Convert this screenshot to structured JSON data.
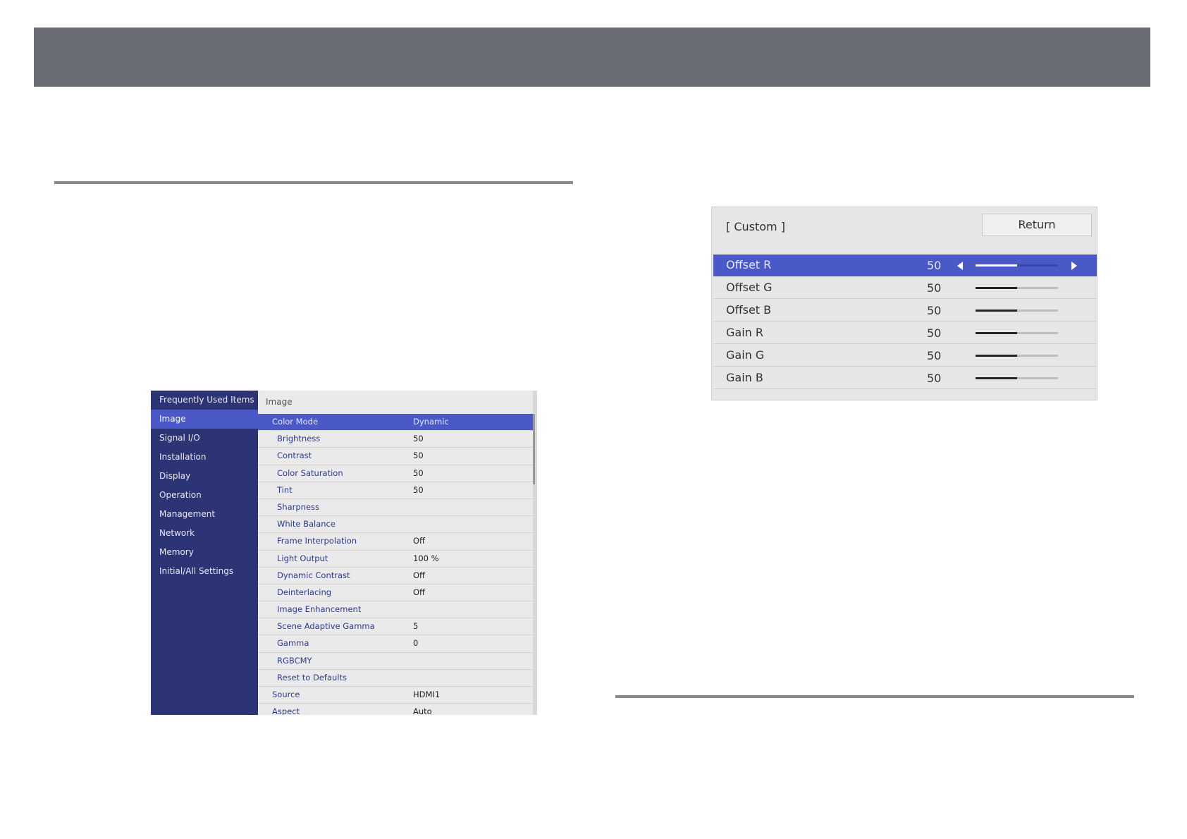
{
  "menu": {
    "sidebar": [
      {
        "label": "Frequently Used Items",
        "active": false
      },
      {
        "label": "Image",
        "active": true
      },
      {
        "label": "Signal I/O",
        "active": false
      },
      {
        "label": "Installation",
        "active": false
      },
      {
        "label": "Display",
        "active": false
      },
      {
        "label": "Operation",
        "active": false
      },
      {
        "label": "Management",
        "active": false
      },
      {
        "label": "Network",
        "active": false
      },
      {
        "label": "Memory",
        "active": false
      },
      {
        "label": "Initial/All Settings",
        "active": false
      }
    ],
    "main_title": "Image",
    "rows": [
      {
        "label": "Color Mode",
        "value": "Dynamic"
      },
      {
        "label": "Brightness",
        "value": "50"
      },
      {
        "label": "Contrast",
        "value": "50"
      },
      {
        "label": "Color Saturation",
        "value": "50"
      },
      {
        "label": "Tint",
        "value": "50"
      },
      {
        "label": "Sharpness",
        "value": ""
      },
      {
        "label": "White Balance",
        "value": ""
      },
      {
        "label": "Frame Interpolation",
        "value": "Off"
      },
      {
        "label": "Light Output",
        "value": "100 %"
      },
      {
        "label": "Dynamic Contrast",
        "value": "Off"
      },
      {
        "label": "Deinterlacing",
        "value": "Off"
      },
      {
        "label": "Image Enhancement",
        "value": ""
      },
      {
        "label": "Scene Adaptive Gamma",
        "value": "5"
      },
      {
        "label": "Gamma",
        "value": "0"
      },
      {
        "label": "RGBCMY",
        "value": ""
      },
      {
        "label": "Reset to Defaults",
        "value": ""
      },
      {
        "label": "Source",
        "value": "HDMI1"
      },
      {
        "label": "Aspect",
        "value": "Auto"
      }
    ]
  },
  "custom_panel": {
    "title": "[ Custom ]",
    "return_label": "Return",
    "rows": [
      {
        "label": "Offset R",
        "value": "50",
        "level": 50
      },
      {
        "label": "Offset G",
        "value": "50",
        "level": 50
      },
      {
        "label": "Offset B",
        "value": "50",
        "level": 50
      },
      {
        "label": "Gain R",
        "value": "50",
        "level": 50
      },
      {
        "label": "Gain G",
        "value": "50",
        "level": 50
      },
      {
        "label": "Gain B",
        "value": "50",
        "level": 50
      }
    ]
  },
  "colors": {
    "header_bar": "#6b6d75",
    "menu_sidebar": "#2d3476",
    "selection": "#4a59c7"
  }
}
